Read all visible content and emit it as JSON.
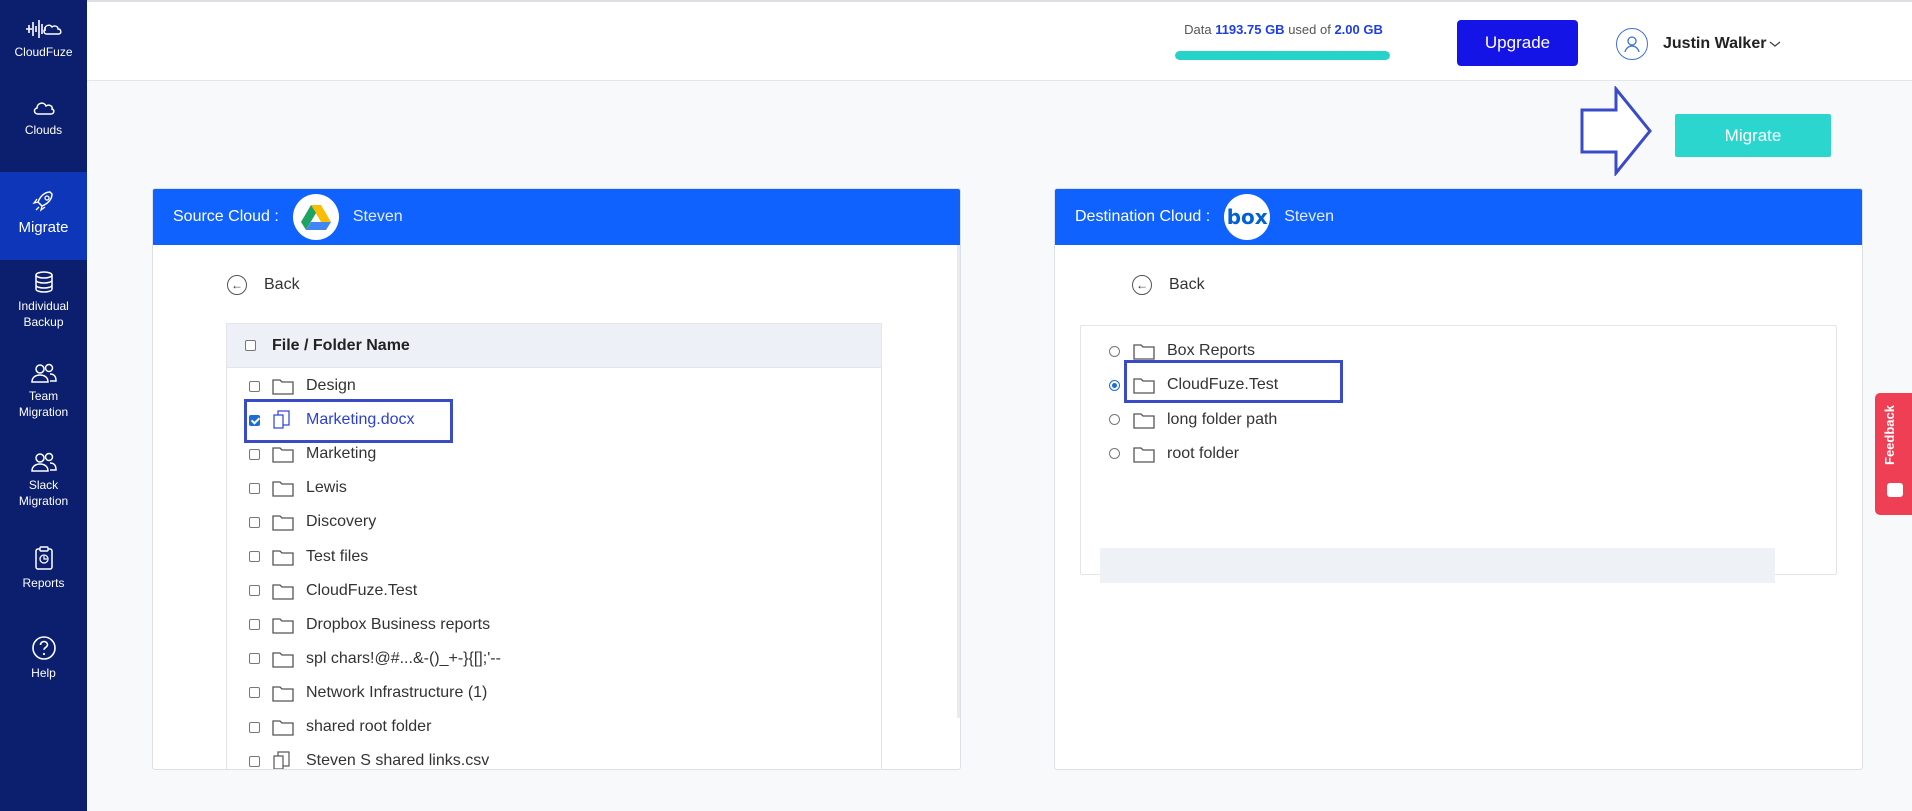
{
  "sidebar": {
    "logo_label": "CloudFuze",
    "items": [
      {
        "label": "Clouds"
      },
      {
        "label": "Migrate"
      },
      {
        "label_line1": "Individual",
        "label_line2": "Backup"
      },
      {
        "label_line1": "Team",
        "label_line2": "Migration"
      },
      {
        "label_line1": "Slack",
        "label_line2": "Migration"
      },
      {
        "label": "Reports"
      },
      {
        "label": "Help"
      }
    ]
  },
  "header": {
    "usage_prefix": "Data ",
    "usage_used": "1193.75 GB",
    "usage_mid": " used of ",
    "usage_total": "2.00 GB",
    "usage_fraction": 1.0,
    "upgrade_label": "Upgrade",
    "user_name": "Justin Walker",
    "accent_color": "#1414e6",
    "usage_color": "#25d3c9"
  },
  "migrate_label": "Migrate",
  "source": {
    "title": "Source Cloud :",
    "cloud_name": "Steven",
    "logo": "google-drive-icon",
    "back_label": "Back",
    "column_header": "File / Folder Name",
    "rows": [
      {
        "name": "Design",
        "type": "folder",
        "checked": false
      },
      {
        "name": "Marketing.docx",
        "type": "file",
        "checked": true
      },
      {
        "name": "Marketing",
        "type": "folder",
        "checked": false
      },
      {
        "name": "Lewis",
        "type": "folder",
        "checked": false
      },
      {
        "name": "Discovery",
        "type": "folder",
        "checked": false
      },
      {
        "name": "Test files",
        "type": "folder",
        "checked": false
      },
      {
        "name": "CloudFuze.Test",
        "type": "folder",
        "checked": false
      },
      {
        "name": "Dropbox Business reports",
        "type": "folder",
        "checked": false
      },
      {
        "name": "spl chars!@#...&-()_+-}{[];'--",
        "type": "folder",
        "checked": false
      },
      {
        "name": "Network Infrastructure (1)",
        "type": "folder",
        "checked": false
      },
      {
        "name": "shared root folder",
        "type": "folder",
        "checked": false
      },
      {
        "name": "Steven S shared links.csv",
        "type": "file",
        "checked": false
      }
    ]
  },
  "destination": {
    "title": "Destination Cloud :",
    "cloud_name": "Steven",
    "logo_text": "box",
    "back_label": "Back",
    "rows": [
      {
        "name": "Box Reports",
        "selected": false
      },
      {
        "name": "CloudFuze.Test",
        "selected": true
      },
      {
        "name": "long folder path",
        "selected": false
      },
      {
        "name": "root folder",
        "selected": false
      }
    ]
  },
  "feedback_label": "Feedback"
}
